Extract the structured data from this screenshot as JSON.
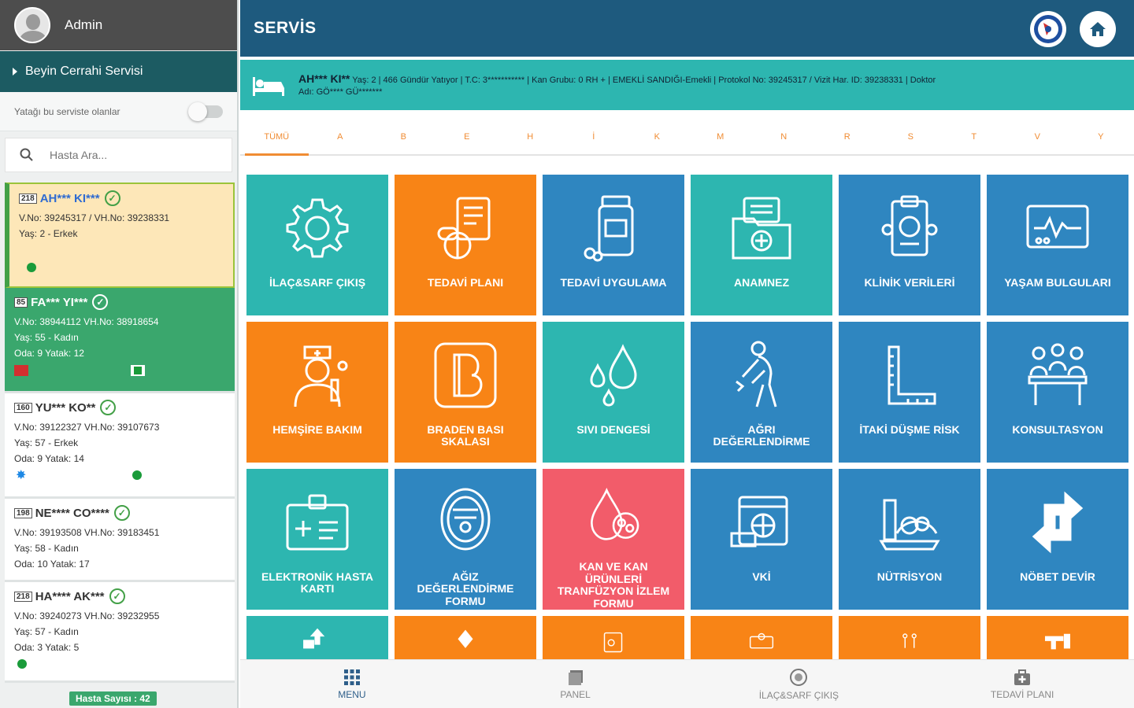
{
  "sidebar": {
    "user_name": "Admin",
    "service_name": "Beyin Cerrahi Servisi",
    "toggle_label": "Yatağı bu serviste olanlar",
    "search_placeholder": "Hasta Ara...",
    "patients": [
      {
        "no": "218",
        "name": "AH*** KI***",
        "line1": "V.No: 39245317 / VH.No: 39238331",
        "line2": "Yaş: 2 - Erkek",
        "line3": ""
      },
      {
        "no": "85",
        "name": "FA*** YI***",
        "line1": "V.No: 38944112 VH.No: 38918654",
        "line2": "Yaş: 55 - Kadın",
        "line3": "Oda: 9 Yatak: 12"
      },
      {
        "no": "160",
        "name": "YU*** KO**",
        "line1": "V.No: 39122327 VH.No: 39107673",
        "line2": "Yaş: 57 - Erkek",
        "line3": "Oda: 9 Yatak: 14"
      },
      {
        "no": "198",
        "name": "NE**** CO****",
        "line1": "V.No: 39193508 VH.No: 39183451",
        "line2": "Yaş: 58 - Kadın",
        "line3": "Oda: 10 Yatak: 17"
      },
      {
        "no": "218",
        "name": "HA**** AK***",
        "line1": "V.No: 39240273 VH.No: 39232955",
        "line2": "Yaş: 57 - Kadın",
        "line3": "Oda: 3 Yatak: 5"
      }
    ],
    "patient_count": "Hasta Sayısı : 42"
  },
  "header": {
    "title": "SERVİS"
  },
  "patient_info": {
    "name": "AH*** KI**",
    "details": "Yaş: 2 | 466 Gündür Yatıyor | T.C: 3*********** | Kan Grubu: 0 RH + | EMEKLİ SANDIĞI-Emekli | Protokol No: 39245317 / Vizit Har. ID: 39238331 | Doktor",
    "doctor": "Adı: GÖ**** GÜ*******"
  },
  "tabs": [
    "TÜMÜ",
    "A",
    "B",
    "E",
    "H",
    "İ",
    "K",
    "M",
    "N",
    "R",
    "S",
    "T",
    "V",
    "Y"
  ],
  "tiles": [
    {
      "label": "İLAÇ&SARF ÇIKIŞ",
      "color": "teal",
      "icon": "gear-icon"
    },
    {
      "label": "TEDAVİ PLANI",
      "color": "orange",
      "icon": "pills-document-icon"
    },
    {
      "label": "TEDAVİ UYGULAMA",
      "color": "blue",
      "icon": "medicine-bottle-icon"
    },
    {
      "label": "ANAMNEZ",
      "color": "teal",
      "icon": "medical-folder-icon"
    },
    {
      "label": "KLİNİK VERİLERİ",
      "color": "blue",
      "icon": "clipboard-icon"
    },
    {
      "label": "YAŞAM BULGULARI",
      "color": "blue",
      "icon": "monitor-icon"
    },
    {
      "label": "HEMŞİRE BAKIM",
      "color": "orange",
      "icon": "nurse-icon"
    },
    {
      "label": "BRADEN BASI SKALASI",
      "color": "orange",
      "icon": "letter-b-icon"
    },
    {
      "label": "SIVI DENGESİ",
      "color": "teal",
      "icon": "drops-icon"
    },
    {
      "label": "AĞRI DEĞERLENDİRME",
      "color": "blue",
      "icon": "pain-person-icon"
    },
    {
      "label": "İTAKİ DÜŞME RİSK",
      "color": "blue",
      "icon": "ruler-icon"
    },
    {
      "label": "KONSULTASYON",
      "color": "blue",
      "icon": "meeting-icon"
    },
    {
      "label": "ELEKTRONİK HASTA KARTI",
      "color": "teal",
      "icon": "id-card-icon"
    },
    {
      "label": "AĞIZ DEĞERLENDİRME FORMU",
      "color": "blue",
      "icon": "mouth-icon"
    },
    {
      "label": "KAN VE KAN ÜRÜNLERİ TRANFÜZYON İZLEM FORMU",
      "color": "red",
      "icon": "blood-drop-icon"
    },
    {
      "label": "VKİ",
      "color": "blue",
      "icon": "calendar-globe-icon"
    },
    {
      "label": "NÜTRİSYON",
      "color": "blue",
      "icon": "food-icon"
    },
    {
      "label": "NÖBET DEVİR",
      "color": "blue",
      "icon": "transfer-arrows-icon"
    }
  ],
  "bottom_nav": [
    {
      "label": "MENU",
      "icon": "grid-icon"
    },
    {
      "label": "PANEL",
      "icon": "panel-icon"
    },
    {
      "label": "İLAÇ&SARF ÇIKIŞ",
      "icon": "pill-icon"
    },
    {
      "label": "TEDAVİ PLANI",
      "icon": "medkit-icon"
    }
  ],
  "colors": {
    "topbar": "#1e5a7e",
    "teal": "#2db6b0",
    "orange": "#f88416",
    "blue": "#2f86c0",
    "red": "#f25c6a"
  }
}
